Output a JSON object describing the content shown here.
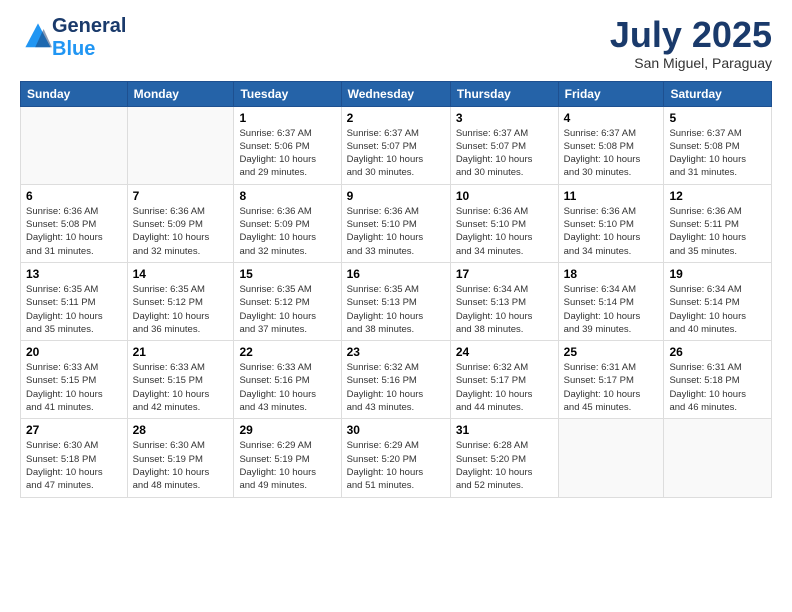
{
  "header": {
    "logo_line1": "General",
    "logo_line2": "Blue",
    "month_year": "July 2025",
    "location": "San Miguel, Paraguay"
  },
  "days_of_week": [
    "Sunday",
    "Monday",
    "Tuesday",
    "Wednesday",
    "Thursday",
    "Friday",
    "Saturday"
  ],
  "weeks": [
    [
      {
        "day": "",
        "info": ""
      },
      {
        "day": "",
        "info": ""
      },
      {
        "day": "1",
        "info": "Sunrise: 6:37 AM\nSunset: 5:06 PM\nDaylight: 10 hours\nand 29 minutes."
      },
      {
        "day": "2",
        "info": "Sunrise: 6:37 AM\nSunset: 5:07 PM\nDaylight: 10 hours\nand 30 minutes."
      },
      {
        "day": "3",
        "info": "Sunrise: 6:37 AM\nSunset: 5:07 PM\nDaylight: 10 hours\nand 30 minutes."
      },
      {
        "day": "4",
        "info": "Sunrise: 6:37 AM\nSunset: 5:08 PM\nDaylight: 10 hours\nand 30 minutes."
      },
      {
        "day": "5",
        "info": "Sunrise: 6:37 AM\nSunset: 5:08 PM\nDaylight: 10 hours\nand 31 minutes."
      }
    ],
    [
      {
        "day": "6",
        "info": "Sunrise: 6:36 AM\nSunset: 5:08 PM\nDaylight: 10 hours\nand 31 minutes."
      },
      {
        "day": "7",
        "info": "Sunrise: 6:36 AM\nSunset: 5:09 PM\nDaylight: 10 hours\nand 32 minutes."
      },
      {
        "day": "8",
        "info": "Sunrise: 6:36 AM\nSunset: 5:09 PM\nDaylight: 10 hours\nand 32 minutes."
      },
      {
        "day": "9",
        "info": "Sunrise: 6:36 AM\nSunset: 5:10 PM\nDaylight: 10 hours\nand 33 minutes."
      },
      {
        "day": "10",
        "info": "Sunrise: 6:36 AM\nSunset: 5:10 PM\nDaylight: 10 hours\nand 34 minutes."
      },
      {
        "day": "11",
        "info": "Sunrise: 6:36 AM\nSunset: 5:10 PM\nDaylight: 10 hours\nand 34 minutes."
      },
      {
        "day": "12",
        "info": "Sunrise: 6:36 AM\nSunset: 5:11 PM\nDaylight: 10 hours\nand 35 minutes."
      }
    ],
    [
      {
        "day": "13",
        "info": "Sunrise: 6:35 AM\nSunset: 5:11 PM\nDaylight: 10 hours\nand 35 minutes."
      },
      {
        "day": "14",
        "info": "Sunrise: 6:35 AM\nSunset: 5:12 PM\nDaylight: 10 hours\nand 36 minutes."
      },
      {
        "day": "15",
        "info": "Sunrise: 6:35 AM\nSunset: 5:12 PM\nDaylight: 10 hours\nand 37 minutes."
      },
      {
        "day": "16",
        "info": "Sunrise: 6:35 AM\nSunset: 5:13 PM\nDaylight: 10 hours\nand 38 minutes."
      },
      {
        "day": "17",
        "info": "Sunrise: 6:34 AM\nSunset: 5:13 PM\nDaylight: 10 hours\nand 38 minutes."
      },
      {
        "day": "18",
        "info": "Sunrise: 6:34 AM\nSunset: 5:14 PM\nDaylight: 10 hours\nand 39 minutes."
      },
      {
        "day": "19",
        "info": "Sunrise: 6:34 AM\nSunset: 5:14 PM\nDaylight: 10 hours\nand 40 minutes."
      }
    ],
    [
      {
        "day": "20",
        "info": "Sunrise: 6:33 AM\nSunset: 5:15 PM\nDaylight: 10 hours\nand 41 minutes."
      },
      {
        "day": "21",
        "info": "Sunrise: 6:33 AM\nSunset: 5:15 PM\nDaylight: 10 hours\nand 42 minutes."
      },
      {
        "day": "22",
        "info": "Sunrise: 6:33 AM\nSunset: 5:16 PM\nDaylight: 10 hours\nand 43 minutes."
      },
      {
        "day": "23",
        "info": "Sunrise: 6:32 AM\nSunset: 5:16 PM\nDaylight: 10 hours\nand 43 minutes."
      },
      {
        "day": "24",
        "info": "Sunrise: 6:32 AM\nSunset: 5:17 PM\nDaylight: 10 hours\nand 44 minutes."
      },
      {
        "day": "25",
        "info": "Sunrise: 6:31 AM\nSunset: 5:17 PM\nDaylight: 10 hours\nand 45 minutes."
      },
      {
        "day": "26",
        "info": "Sunrise: 6:31 AM\nSunset: 5:18 PM\nDaylight: 10 hours\nand 46 minutes."
      }
    ],
    [
      {
        "day": "27",
        "info": "Sunrise: 6:30 AM\nSunset: 5:18 PM\nDaylight: 10 hours\nand 47 minutes."
      },
      {
        "day": "28",
        "info": "Sunrise: 6:30 AM\nSunset: 5:19 PM\nDaylight: 10 hours\nand 48 minutes."
      },
      {
        "day": "29",
        "info": "Sunrise: 6:29 AM\nSunset: 5:19 PM\nDaylight: 10 hours\nand 49 minutes."
      },
      {
        "day": "30",
        "info": "Sunrise: 6:29 AM\nSunset: 5:20 PM\nDaylight: 10 hours\nand 51 minutes."
      },
      {
        "day": "31",
        "info": "Sunrise: 6:28 AM\nSunset: 5:20 PM\nDaylight: 10 hours\nand 52 minutes."
      },
      {
        "day": "",
        "info": ""
      },
      {
        "day": "",
        "info": ""
      }
    ]
  ]
}
